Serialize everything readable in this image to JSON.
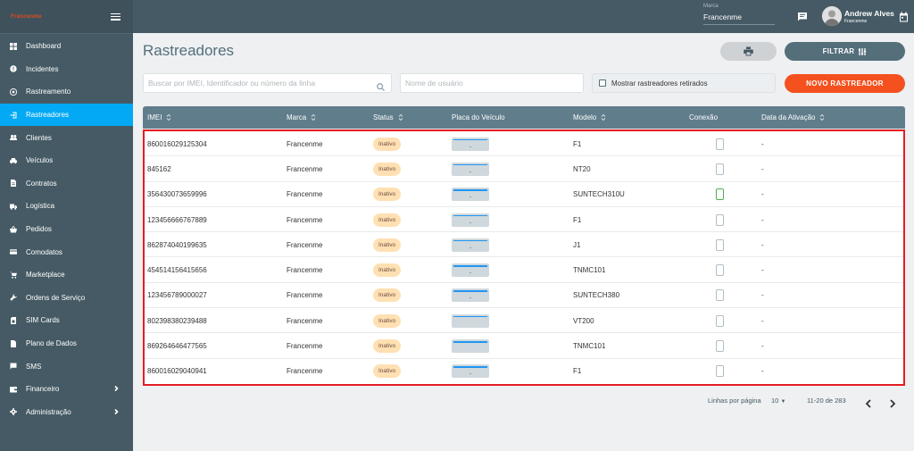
{
  "sidebar": {
    "logo_left": "Francenme",
    "logo_right": "",
    "items": [
      {
        "label": "Dashboard",
        "icon": "dashboard-icon"
      },
      {
        "label": "Incidentes",
        "icon": "alert-icon"
      },
      {
        "label": "Rastreamento",
        "icon": "target-icon"
      },
      {
        "label": "Rastreadores",
        "icon": "login-icon",
        "active": true
      },
      {
        "label": "Clientes",
        "icon": "people-icon"
      },
      {
        "label": "Veículos",
        "icon": "car-icon"
      },
      {
        "label": "Contratos",
        "icon": "document-icon"
      },
      {
        "label": "Logística",
        "icon": "truck-icon"
      },
      {
        "label": "Pedidos",
        "icon": "basket-icon"
      },
      {
        "label": "Comodatos",
        "icon": "card-icon"
      },
      {
        "label": "Marketplace",
        "icon": "cart-icon"
      },
      {
        "label": "Ordens de Serviço",
        "icon": "wrench-icon"
      },
      {
        "label": "SIM Cards",
        "icon": "simcard-icon"
      },
      {
        "label": "Plano de Dados",
        "icon": "file-icon"
      },
      {
        "label": "SMS",
        "icon": "message-icon"
      },
      {
        "label": "Financeiro",
        "icon": "wallet-icon",
        "expandable": true
      },
      {
        "label": "Administração",
        "icon": "gear-icon",
        "expandable": true
      }
    ]
  },
  "topbar": {
    "brand_label": "Marca",
    "brand_value": "Francenme",
    "user_name": "Andrew Alves",
    "user_company": "Francenme"
  },
  "page": {
    "title": "Rastreadores",
    "filter_label": "FILTRAR",
    "new_label": "NOVO RASTREADOR",
    "search_placeholder": "Buscar por IMEI, Identificador ou número da linha",
    "user_placeholder": "Nome de usuário",
    "retired_label": "Mostrar rastreadores retirados"
  },
  "table": {
    "columns": [
      "IMEI",
      "Marca",
      "Status",
      "Placa do Veículo",
      "Modelo",
      "Conexão",
      "Data da Ativação"
    ],
    "rows": [
      {
        "imei": "860016029125304",
        "marca": "Francenme",
        "status": "Inativo",
        "placa": "-",
        "modelo": "F1",
        "conexao": false,
        "data": "-"
      },
      {
        "imei": "845162",
        "marca": "Francenme",
        "status": "Inativo",
        "placa": "-",
        "modelo": "NT20",
        "conexao": false,
        "data": "-"
      },
      {
        "imei": "356430073659996",
        "marca": "Francenme",
        "status": "Inativo",
        "placa": "-",
        "modelo": "SUNTECH310U",
        "conexao": true,
        "data": "-"
      },
      {
        "imei": "123456666767889",
        "marca": "Francenme",
        "status": "Inativo",
        "placa": "-",
        "modelo": "F1",
        "conexao": false,
        "data": "-"
      },
      {
        "imei": "862874040199635",
        "marca": "Francenme",
        "status": "Inativo",
        "placa": "-",
        "modelo": "J1",
        "conexao": false,
        "data": "-"
      },
      {
        "imei": "454514156415656",
        "marca": "Francenme",
        "status": "Inativo",
        "placa": "-",
        "modelo": "TNMC101",
        "conexao": false,
        "data": "-"
      },
      {
        "imei": "123456789000027",
        "marca": "Francenme",
        "status": "Inativo",
        "placa": "-",
        "modelo": "SUNTECH380",
        "conexao": false,
        "data": "-"
      },
      {
        "imei": "802398380239488",
        "marca": "Francenme",
        "status": "Inativo",
        "placa": "",
        "modelo": "VT200",
        "conexao": false,
        "data": "-"
      },
      {
        "imei": "869264646477565",
        "marca": "Francenme",
        "status": "Inativo",
        "placa": "",
        "modelo": "TNMC101",
        "conexao": false,
        "data": "-"
      },
      {
        "imei": "860016029040941",
        "marca": "Francenme",
        "status": "Inativo",
        "placa": "-",
        "modelo": "F1",
        "conexao": false,
        "data": "-"
      }
    ]
  },
  "pagination": {
    "rows_label": "Linhas por página",
    "rows_value": "10",
    "range": "11-20 de 283"
  }
}
